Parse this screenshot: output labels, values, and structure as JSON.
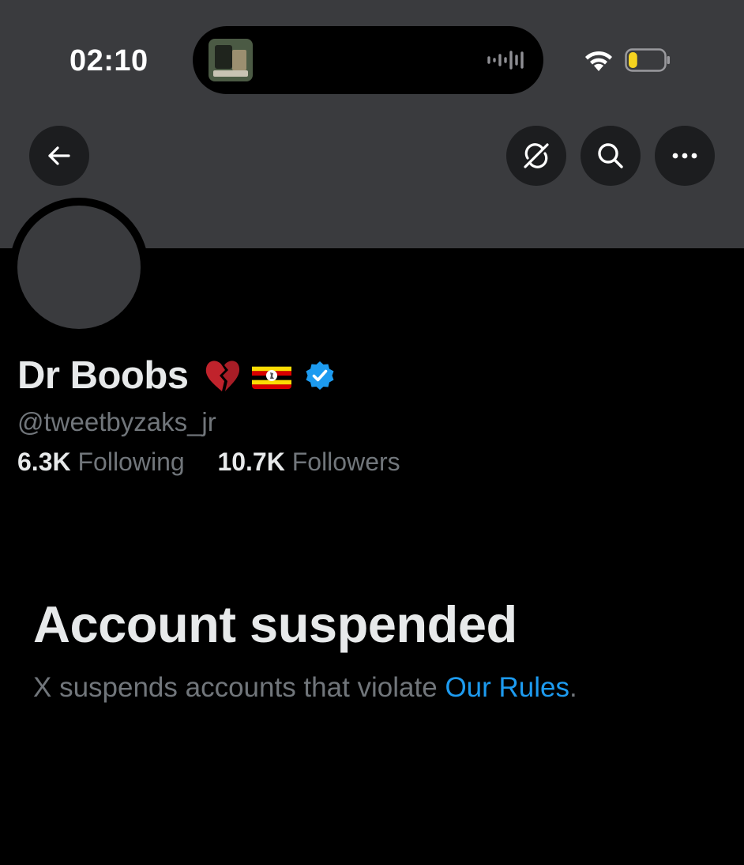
{
  "status_bar": {
    "time": "02:10",
    "icons": [
      "now-playing-artwork",
      "audio-waveform-icon",
      "wifi-icon",
      "battery-low-icon"
    ],
    "battery_level": 0.25,
    "battery_color": "#f5d31f"
  },
  "nav": {
    "back_icon": "arrow-left-icon",
    "buttons": [
      "no-sync-icon",
      "search-icon",
      "more-icon"
    ]
  },
  "profile": {
    "display_name": "Dr Boobs",
    "name_emojis": [
      "broken-heart-emoji",
      "uganda-flag-emoji"
    ],
    "verified": true,
    "handle": "@tweetbyzaks_jr",
    "following_count": "6.3K",
    "following_label": "Following",
    "followers_count": "10.7K",
    "followers_label": "Followers"
  },
  "suspension": {
    "title": "Account suspended",
    "description_prefix": "X suspends accounts that violate ",
    "rules_link": "Our Rules",
    "description_suffix": "."
  },
  "colors": {
    "background": "#000000",
    "banner": "#3a3b3e",
    "primary_text": "#e7e9ea",
    "secondary_text": "#71767b",
    "link": "#1d9bf0",
    "verified_badge": "#1d9bf0"
  }
}
